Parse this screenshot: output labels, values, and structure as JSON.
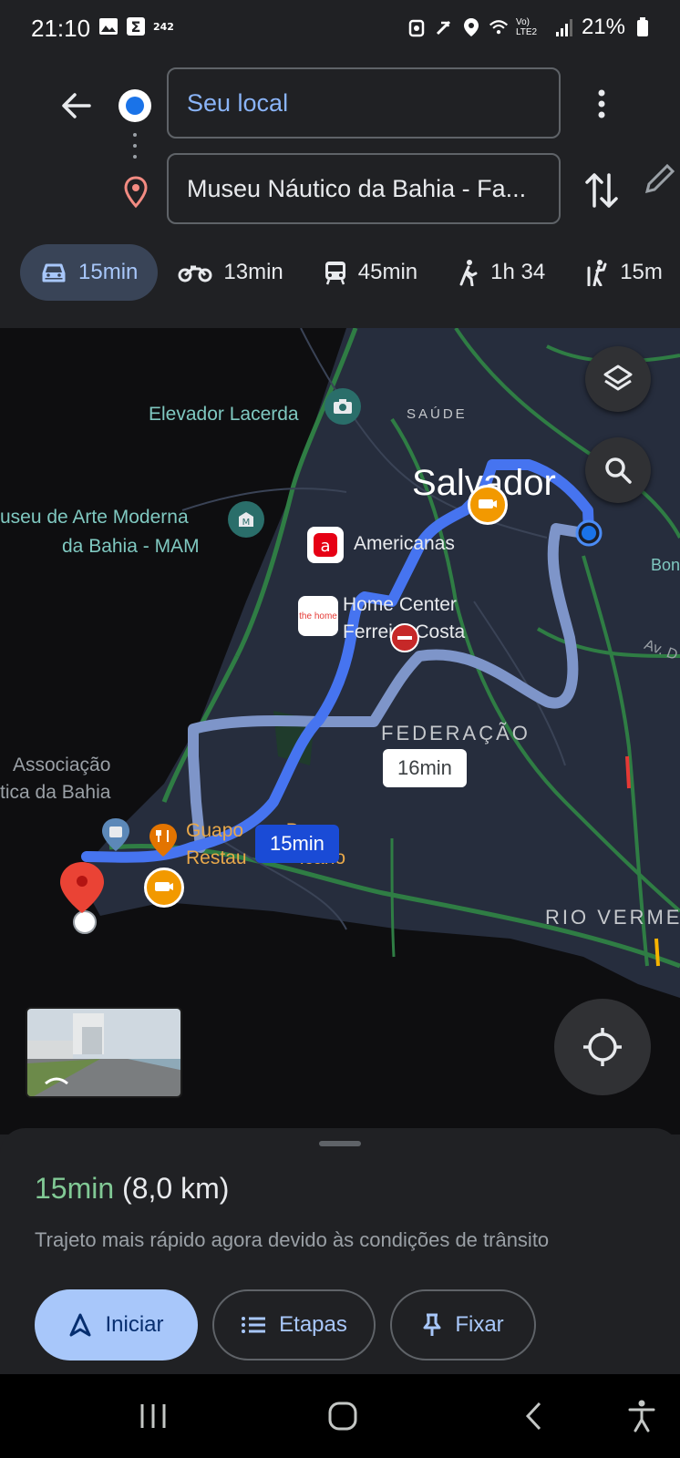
{
  "status_bar": {
    "time": "21:10",
    "battery": "21%",
    "network": "Vo) LTE2",
    "icons": [
      "gallery-icon",
      "sigma-icon",
      "notification-icon",
      "alarm-icon",
      "mute-icon",
      "location-icon",
      "wifi-icon",
      "signal-icon",
      "battery-icon"
    ]
  },
  "directions": {
    "origin": "Seu local",
    "destination": "Museu Náutico da Bahia - Fa..."
  },
  "modes": [
    {
      "name": "car",
      "label": "15min",
      "active": true
    },
    {
      "name": "motorcycle",
      "label": "13min",
      "active": false
    },
    {
      "name": "transit",
      "label": "45min",
      "active": false
    },
    {
      "name": "walk",
      "label": "1h 34",
      "active": false
    },
    {
      "name": "ride",
      "label": "15m",
      "active": false
    }
  ],
  "map": {
    "labels": {
      "elevador": "Elevador Lacerda",
      "saude": "SAÚDE",
      "salvador": "Salvador",
      "museu_line1": "useu de Arte Moderna",
      "museu_line2": "da Bahia - MAM",
      "americanas": "Americanas",
      "home_center_line1": "Home Center",
      "home_center_line2": "Ferreira Costa",
      "bonocó": "Bon",
      "av": "Av. D",
      "federacao": "FEDERAÇÃO",
      "associacao_line1": "Associação",
      "associacao_line2": "tica da Bahia",
      "guapo_line1": "Guapo        Bar -",
      "guapo_line2": "Restau          icano",
      "rio_vermelho": "RIO VERME",
      "home_logo_text": "the home"
    },
    "route_primary": "15min",
    "route_alternative": "16min"
  },
  "sheet": {
    "time": "15min",
    "distance": "(8,0 km)",
    "description": "Trajeto mais rápido agora devido às condições de trânsito",
    "buttons": {
      "start": "Iniciar",
      "steps": "Etapas",
      "pin": "Fixar"
    }
  },
  "colors": {
    "accent_blue": "#8ab4f8",
    "primary_button": "#a8c7fa",
    "route_blue": "#1a4bd6",
    "time_green": "#81c995"
  }
}
